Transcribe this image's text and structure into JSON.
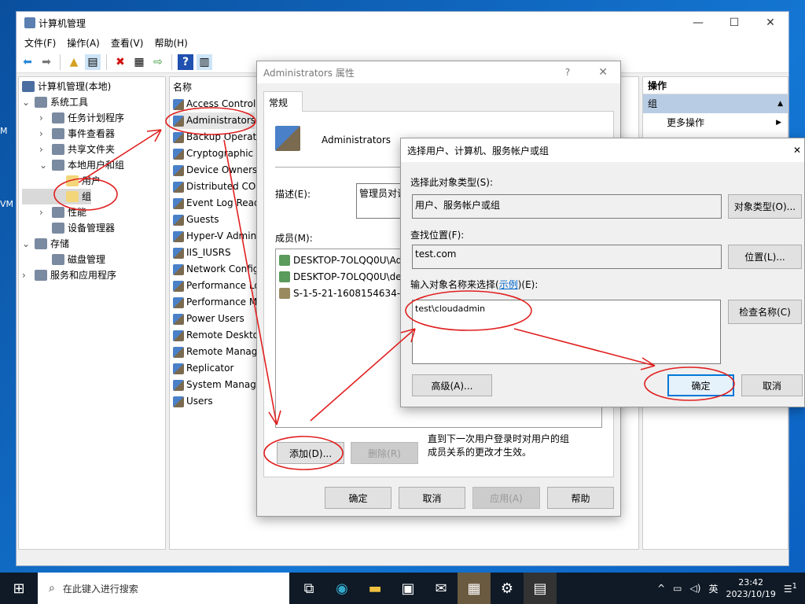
{
  "desktop": {
    "icon_labels": [
      "M",
      "VM"
    ]
  },
  "main_window": {
    "title": "计算机管理",
    "controls": [
      "—",
      "☐",
      "✕"
    ],
    "menu": [
      "文件(F)",
      "操作(A)",
      "查看(V)",
      "帮助(H)"
    ],
    "tree": {
      "root": "计算机管理(本地)",
      "items": [
        {
          "label": "系统工具",
          "level": 0,
          "expand": "open"
        },
        {
          "label": "任务计划程序",
          "level": 1,
          "expand": "closed"
        },
        {
          "label": "事件查看器",
          "level": 1,
          "expand": "closed"
        },
        {
          "label": "共享文件夹",
          "level": 1,
          "expand": "closed"
        },
        {
          "label": "本地用户和组",
          "level": 1,
          "expand": "open"
        },
        {
          "label": "用户",
          "level": 2,
          "expand": ""
        },
        {
          "label": "组",
          "level": 2,
          "expand": "",
          "selected": true
        },
        {
          "label": "性能",
          "level": 1,
          "expand": "closed"
        },
        {
          "label": "设备管理器",
          "level": 1,
          "expand": ""
        },
        {
          "label": "存储",
          "level": 0,
          "expand": "open"
        },
        {
          "label": "磁盘管理",
          "level": 1,
          "expand": ""
        },
        {
          "label": "服务和应用程序",
          "level": 0,
          "expand": "closed"
        }
      ]
    },
    "list": {
      "header": "名称",
      "items": [
        "Access Control",
        "Administrators",
        "Backup Operat",
        "Cryptographic",
        "Device Owners",
        "Distributed CO",
        "Event Log Read",
        "Guests",
        "Hyper-V Admin",
        "IIS_IUSRS",
        "Network Config",
        "Performance Lo",
        "Performance M",
        "Power Users",
        "Remote Deskto",
        "Remote Manag",
        "Replicator",
        "System Manag",
        "Users"
      ]
    },
    "actions": {
      "header": "操作",
      "section": "组",
      "more": "更多操作"
    }
  },
  "props_dialog": {
    "title": "Administrators 属性",
    "help": "?",
    "close": "✕",
    "tab": "常规",
    "group_name": "Administrators",
    "desc_label": "描述(E):",
    "desc_value": "管理员对计",
    "members_label": "成员(M):",
    "members": [
      "DESKTOP-7OLQQ0U\\Ad",
      "DESKTOP-7OLQQ0U\\de",
      "S-1-5-21-1608154634-3"
    ],
    "add": "添加(D)...",
    "remove": "删除(R)",
    "note": "直到下一次用户登录时对用户的组成员关系的更改才生效。",
    "ok": "确定",
    "cancel": "取消",
    "apply": "应用(A)",
    "help_btn": "帮助"
  },
  "select_dialog": {
    "title": "选择用户、计算机、服务帐户或组",
    "close": "✕",
    "type_label": "选择此对象类型(S):",
    "type_value": "用户、服务帐户或组",
    "type_btn": "对象类型(O)...",
    "loc_label": "查找位置(F):",
    "loc_value": "test.com",
    "loc_btn": "位置(L)...",
    "name_label": "输入对象名称来选择",
    "name_link": "示例",
    "name_label_suffix": "(E):",
    "name_value": "test\\cloudadmin",
    "check_btn": "检查名称(C)",
    "advanced": "高级(A)...",
    "ok": "确定",
    "cancel": "取消"
  },
  "taskbar": {
    "search_placeholder": "在此键入进行搜索",
    "time": "23:42",
    "date": "2023/10/19",
    "ime": "英",
    "notif_count": "1"
  },
  "annotation_color": "#e02020"
}
